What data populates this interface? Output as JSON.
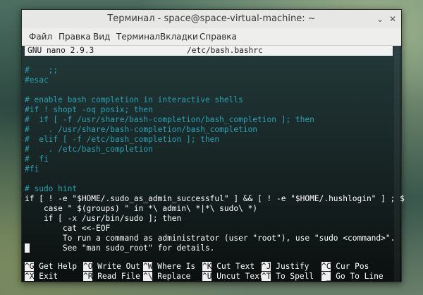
{
  "window": {
    "title": "Терминал - space@space-virtual-machine: ~",
    "minimize_icon": "chevron-down-icon",
    "close_icon": "close-icon"
  },
  "menu": [
    "Файл",
    "Правка",
    "Вид",
    "Терминал",
    "Вкладки",
    "Справка"
  ],
  "nano": {
    "version": "GNU nano 2.9.3",
    "filename": "/etc/bash.bashrc"
  },
  "lines": [
    {
      "text": "#    ;;",
      "color": "#2aa1b3"
    },
    {
      "text": "#esac",
      "color": "#2aa1b3"
    },
    {
      "text": "",
      "color": "#2aa1b3"
    },
    {
      "text": "# enable bash completion in interactive shells",
      "color": "#2aa1b3"
    },
    {
      "text": "#if ! shopt -oq posix; then",
      "color": "#2aa1b3"
    },
    {
      "text": "#  if [ -f /usr/share/bash-completion/bash_completion ]; then",
      "color": "#2aa1b3"
    },
    {
      "text": "#    . /usr/share/bash-completion/bash_completion",
      "color": "#2aa1b3"
    },
    {
      "text": "#  elif [ -f /etc/bash_completion ]; then",
      "color": "#2aa1b3"
    },
    {
      "text": "#    . /etc/bash_completion",
      "color": "#2aa1b3"
    },
    {
      "text": "#  fi",
      "color": "#2aa1b3"
    },
    {
      "text": "#fi",
      "color": "#2aa1b3"
    },
    {
      "text": "",
      "color": "#2aa1b3"
    },
    {
      "text": "# sudo hint",
      "color": "#2aa1b3"
    },
    {
      "text": "if [ ! -e \"$HOME/.sudo_as_admin_successful\" ] && [ ! -e \"$HOME/.hushlogin\" ] ; $",
      "color": "#ffffff"
    },
    {
      "text": "    case \" $(groups) \" in *\\ admin\\ *|*\\ sudo\\ *)",
      "color": "#ffffff"
    },
    {
      "text": "    if [ -x /usr/bin/sudo ]; then",
      "color": "#ffffff"
    },
    {
      "text": "        cat <<-EOF",
      "color": "#ffffff"
    },
    {
      "text": "        To run a command as administrator (user \"root\"), use \"sudo <command>\".",
      "color": "#ffffff"
    },
    {
      "text": "        See \"man sudo_root\" for details.",
      "color": "#ffffff"
    }
  ],
  "shortcuts_row1": [
    {
      "key": "^G",
      "label": "Get Help"
    },
    {
      "key": "^O",
      "label": "Write Out"
    },
    {
      "key": "^W",
      "label": "Where Is"
    },
    {
      "key": "^K",
      "label": "Cut Text"
    },
    {
      "key": "^J",
      "label": "Justify"
    },
    {
      "key": "^C",
      "label": "Cur Pos"
    }
  ],
  "shortcuts_row2": [
    {
      "key": "^X",
      "label": "Exit"
    },
    {
      "key": "^R",
      "label": "Read File"
    },
    {
      "key": "^\\",
      "label": "Replace"
    },
    {
      "key": "^U",
      "label": "Uncut Text"
    },
    {
      "key": "^T",
      "label": "To Spell"
    },
    {
      "key": "^_",
      "label": "Go To Line"
    }
  ]
}
